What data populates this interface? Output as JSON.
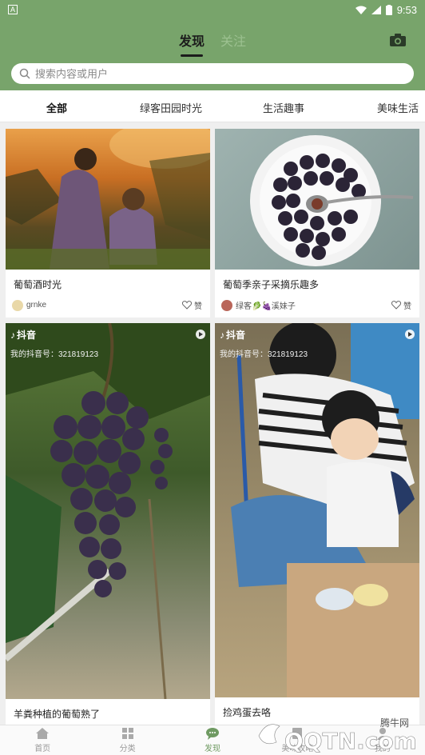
{
  "statusbar": {
    "left_icon": "a-icon",
    "time": "9:53"
  },
  "header": {
    "tabs": [
      {
        "label": "发现"
      },
      {
        "label": "关注"
      }
    ],
    "camera_icon": "camera-icon"
  },
  "search": {
    "placeholder": "搜索内容或用户"
  },
  "categories": [
    "全部",
    "绿客田园时光",
    "生活趣事",
    "美味生活"
  ],
  "cards": [
    {
      "title": "葡萄酒时光",
      "author": "grnke",
      "like_label": "赞"
    },
    {
      "title": "葡萄季亲子采摘乐趣多",
      "author": "绿客🥬🍇溪妹子",
      "like_label": "赞"
    },
    {
      "title": "羊粪种植的葡萄熟了",
      "tiktok_label": "抖音",
      "tiktok_id": "我的抖音号：321819123"
    },
    {
      "title": "捡鸡蛋去咯",
      "tiktok_label": "抖音",
      "tiktok_id": "我的抖音号：321819123"
    }
  ],
  "bottom_nav": [
    {
      "label": "首页"
    },
    {
      "label": "分类"
    },
    {
      "label": "发现"
    },
    {
      "label": "美味攻略"
    },
    {
      "label": "我的"
    }
  ],
  "watermark": {
    "text": "腾牛网",
    "site": "QQTN.com"
  },
  "colors": {
    "header": "#78a46b",
    "active_nav": "#6f9a62"
  }
}
